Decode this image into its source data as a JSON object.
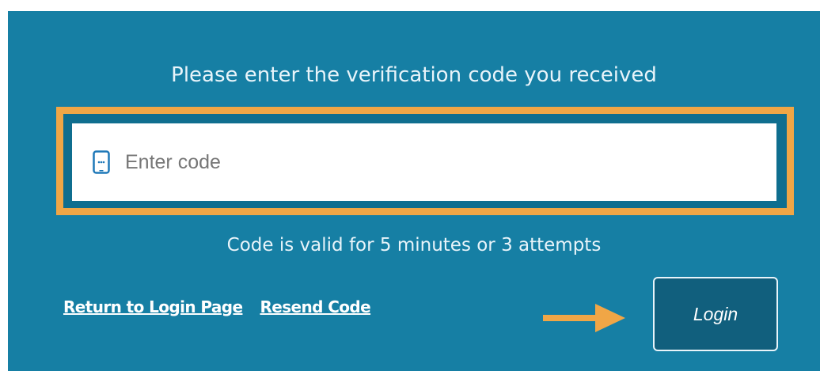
{
  "form": {
    "prompt": "Please enter the verification code you received",
    "code_input": {
      "value": "",
      "placeholder": "Enter code",
      "icon": "mobile-phone-icon"
    },
    "validity_note": "Code is valid for 5 minutes or 3 attempts",
    "return_link": "Return to Login Page",
    "resend_link": "Resend Code",
    "login_button": "Login"
  },
  "colors": {
    "panel": "#167fa4",
    "highlight_border": "#f0a646",
    "button_bg": "#115f7d",
    "arrow": "#f0a646"
  }
}
